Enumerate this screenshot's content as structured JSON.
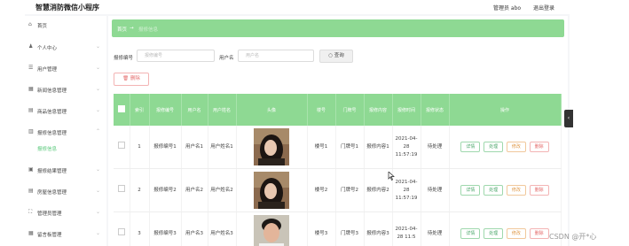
{
  "app": {
    "title": "智慧消防微信小程序"
  },
  "topbar": {
    "user": "管理员 abo",
    "logout": "退出登录"
  },
  "sidebar": {
    "items": [
      {
        "label": "首页",
        "icon": "home-icon"
      },
      {
        "label": "个人中心",
        "icon": "user-icon"
      },
      {
        "label": "用户管理",
        "icon": "users-icon"
      },
      {
        "label": "新闻信息管理",
        "icon": "news-icon"
      },
      {
        "label": "商品信息管理",
        "icon": "goods-icon"
      },
      {
        "label": "报修信息管理",
        "icon": "chart-icon"
      },
      {
        "label": "报修结果管理",
        "icon": "result-icon"
      },
      {
        "label": "房屋信息管理",
        "icon": "house-icon"
      },
      {
        "label": "管理员管理",
        "icon": "admin-icon"
      },
      {
        "label": "留言板管理",
        "icon": "message-icon"
      }
    ],
    "active_sub": "报修信息"
  },
  "breadcrumb": {
    "home": "首页",
    "sep": "→",
    "current": "报修信息"
  },
  "search": {
    "field1_label": "报修编号",
    "field1_placeholder": "报修编号",
    "field2_label": "用户名",
    "field2_placeholder": "用户名",
    "query_button": "查询"
  },
  "actions": {
    "delete": "删除"
  },
  "table": {
    "headers": [
      "",
      "索引",
      "报修编号",
      "用户名",
      "用户姓名",
      "头像",
      "楼号",
      "门牌号",
      "报修内容",
      "报修时间",
      "报修状态",
      "操作"
    ],
    "rows": [
      {
        "index": "1",
        "code": "报修编号1",
        "username": "用户名1",
        "realname": "用户姓名1",
        "building": "楼号1",
        "door": "门牌号1",
        "content": "报修内容1",
        "time": "2021-04-28 11:57:19",
        "status": "待处理"
      },
      {
        "index": "2",
        "code": "报修编号2",
        "username": "用户名2",
        "realname": "用户姓名2",
        "building": "楼号2",
        "door": "门牌号2",
        "content": "报修内容2",
        "time": "2021-04-28 11:57:19",
        "status": "待处理"
      },
      {
        "index": "3",
        "code": "报修编号3",
        "username": "用户名3",
        "realname": "用户姓名3",
        "building": "楼号3",
        "door": "门牌号3",
        "content": "报修内容3",
        "time": "2021-04-28 11:5",
        "status": "待处理"
      }
    ],
    "op_labels": {
      "detail": "详情",
      "handle": "处理",
      "edit": "修改",
      "delete": "删除"
    }
  },
  "watermark": "CSDN @开*心"
}
